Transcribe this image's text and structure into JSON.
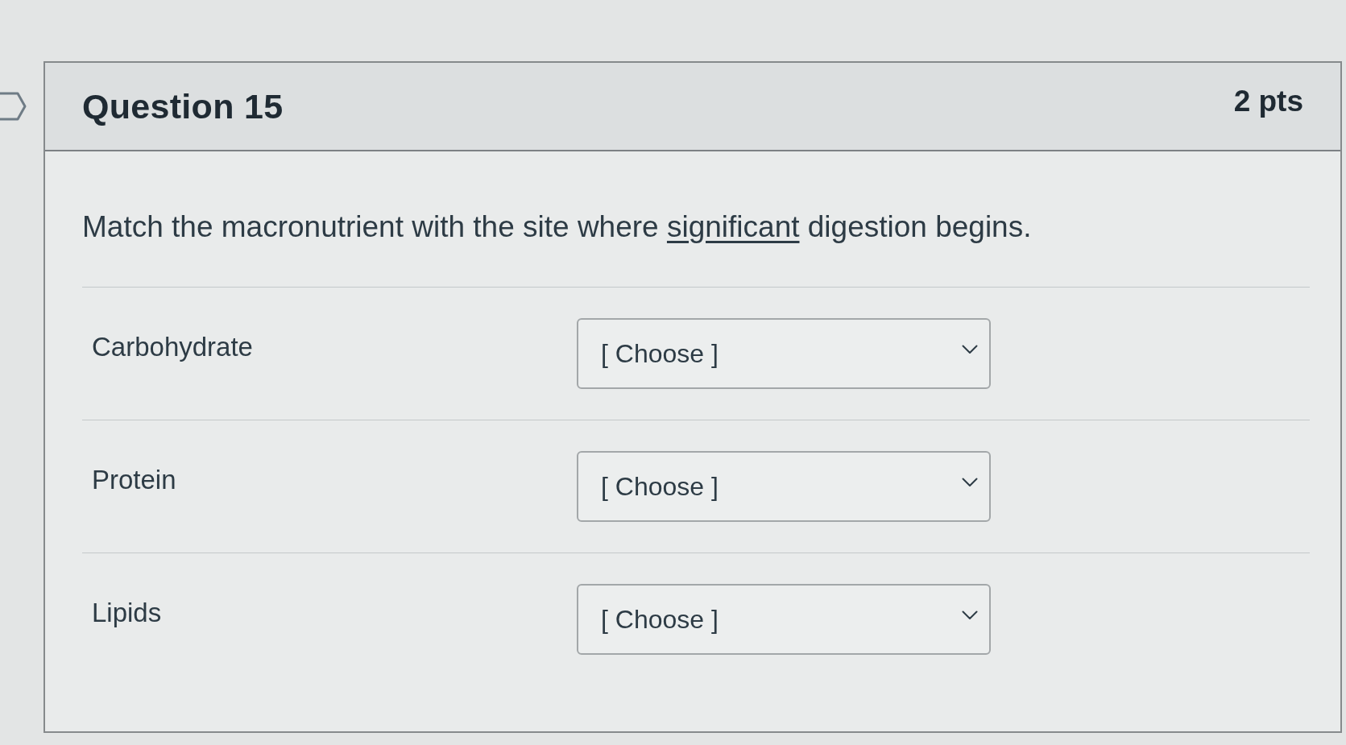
{
  "question": {
    "title": "Question 15",
    "points": "2 pts",
    "prompt": [
      {
        "text": "Match the macronutrient with the site where ",
        "underline": false
      },
      {
        "text": "significant",
        "underline": true
      },
      {
        "text": " digestion begins.",
        "underline": false
      }
    ]
  },
  "matches": [
    {
      "term": "Carbohydrate",
      "value": "[ Choose ]"
    },
    {
      "term": "Protein",
      "value": "[ Choose ]"
    },
    {
      "term": "Lipids",
      "value": "[ Choose ]"
    }
  ]
}
